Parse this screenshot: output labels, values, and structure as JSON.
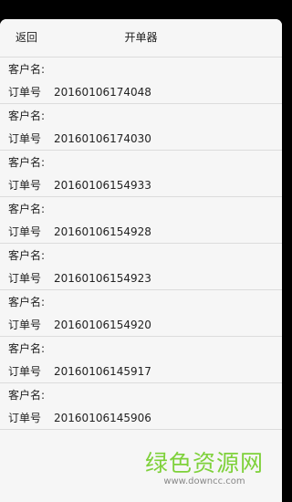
{
  "header": {
    "back_label": "返回",
    "title": "开单器"
  },
  "orders": [
    {
      "customer_label": "客户名:",
      "customer_name": "",
      "order_label": "订单号",
      "order_number": "20160106174048"
    },
    {
      "customer_label": "客户名:",
      "customer_name": "",
      "order_label": "订单号",
      "order_number": "20160106174030"
    },
    {
      "customer_label": "客户名:",
      "customer_name": "",
      "order_label": "订单号",
      "order_number": "20160106154933"
    },
    {
      "customer_label": "客户名:",
      "customer_name": "",
      "order_label": "订单号",
      "order_number": "20160106154928"
    },
    {
      "customer_label": "客户名:",
      "customer_name": "",
      "order_label": "订单号",
      "order_number": "20160106154923"
    },
    {
      "customer_label": "客户名:",
      "customer_name": "",
      "order_label": "订单号",
      "order_number": "20160106154920"
    },
    {
      "customer_label": "客户名:",
      "customer_name": "",
      "order_label": "订单号",
      "order_number": "20160106145917"
    },
    {
      "customer_label": "客户名:",
      "customer_name": "",
      "order_label": "订单号",
      "order_number": "20160106145906"
    }
  ],
  "watermark": {
    "text": "绿色资源网",
    "url": "www.downcc.com"
  }
}
